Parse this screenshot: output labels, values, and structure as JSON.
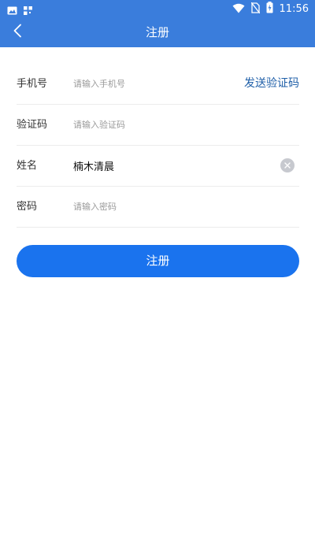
{
  "status_bar": {
    "time": "11:56",
    "left_icons": [
      "image-icon",
      "qr-icon"
    ],
    "right_icons": [
      "wifi-icon",
      "no-sim-icon",
      "battery-charging-icon"
    ]
  },
  "header": {
    "title": "注册",
    "back_icon": "chevron-left-icon",
    "background": "#3a7ddc"
  },
  "form": {
    "phone": {
      "label": "手机号",
      "placeholder": "请输入手机号",
      "value": ""
    },
    "send_code_label": "发送验证码",
    "code": {
      "label": "验证码",
      "placeholder": "请输入验证码",
      "value": ""
    },
    "name": {
      "label": "姓名",
      "placeholder": "",
      "value": "楠木清晨"
    },
    "password": {
      "label": "密码",
      "placeholder": "请输入密码",
      "value": ""
    }
  },
  "submit_button": {
    "label": "注册",
    "color": "#1a73ee"
  }
}
